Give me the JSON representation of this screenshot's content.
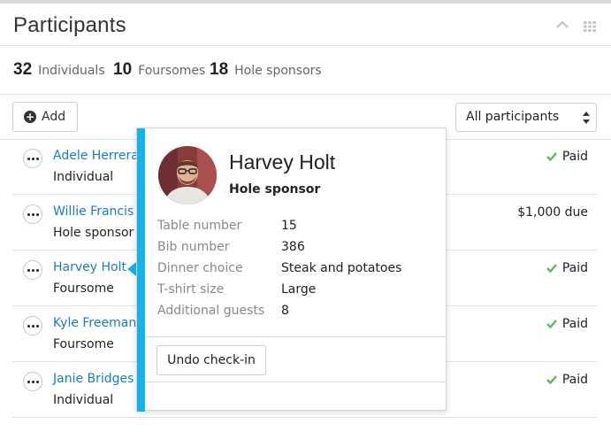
{
  "header": {
    "title": "Participants"
  },
  "stats": [
    {
      "count": "32",
      "label": "Individuals"
    },
    {
      "count": "10",
      "label": "Foursomes"
    },
    {
      "count": "18",
      "label": "Hole sponsors"
    }
  ],
  "toolbar": {
    "add_label": "Add",
    "filter_value": "All participants"
  },
  "participants": [
    {
      "name": "Adele Herrera",
      "type": "Individual",
      "status": "Paid",
      "paid": true
    },
    {
      "name": "Willie Francis",
      "type": "Hole sponsor",
      "status": "$1,000 due",
      "paid": false
    },
    {
      "name": "Harvey Holt",
      "type": "Foursome",
      "status": "Paid",
      "paid": true
    },
    {
      "name": "Kyle Freeman",
      "type": "Foursome",
      "status": "Paid",
      "paid": true
    },
    {
      "name": "Janie Bridges",
      "type": "Individual",
      "status": "Paid",
      "paid": true
    }
  ],
  "popover": {
    "name": "Harvey Holt",
    "role": "Hole sponsor",
    "details": [
      {
        "label": "Table number",
        "value": "15"
      },
      {
        "label": "Bib number",
        "value": "386"
      },
      {
        "label": "Dinner choice",
        "value": "Steak and potatoes"
      },
      {
        "label": "T-shirt size",
        "value": "Large"
      },
      {
        "label": "Additional guests",
        "value": "8"
      }
    ],
    "undo_label": "Undo check-in"
  },
  "colors": {
    "accent": "#16b3ea",
    "link": "#1a7cb8",
    "paid_check": "#5cb85c"
  },
  "icons": {
    "collapse": "chevron-up-icon",
    "grid": "grid-icon",
    "add": "plus-circle-icon",
    "more": "more-horizontal-icon",
    "paid": "check-icon"
  }
}
